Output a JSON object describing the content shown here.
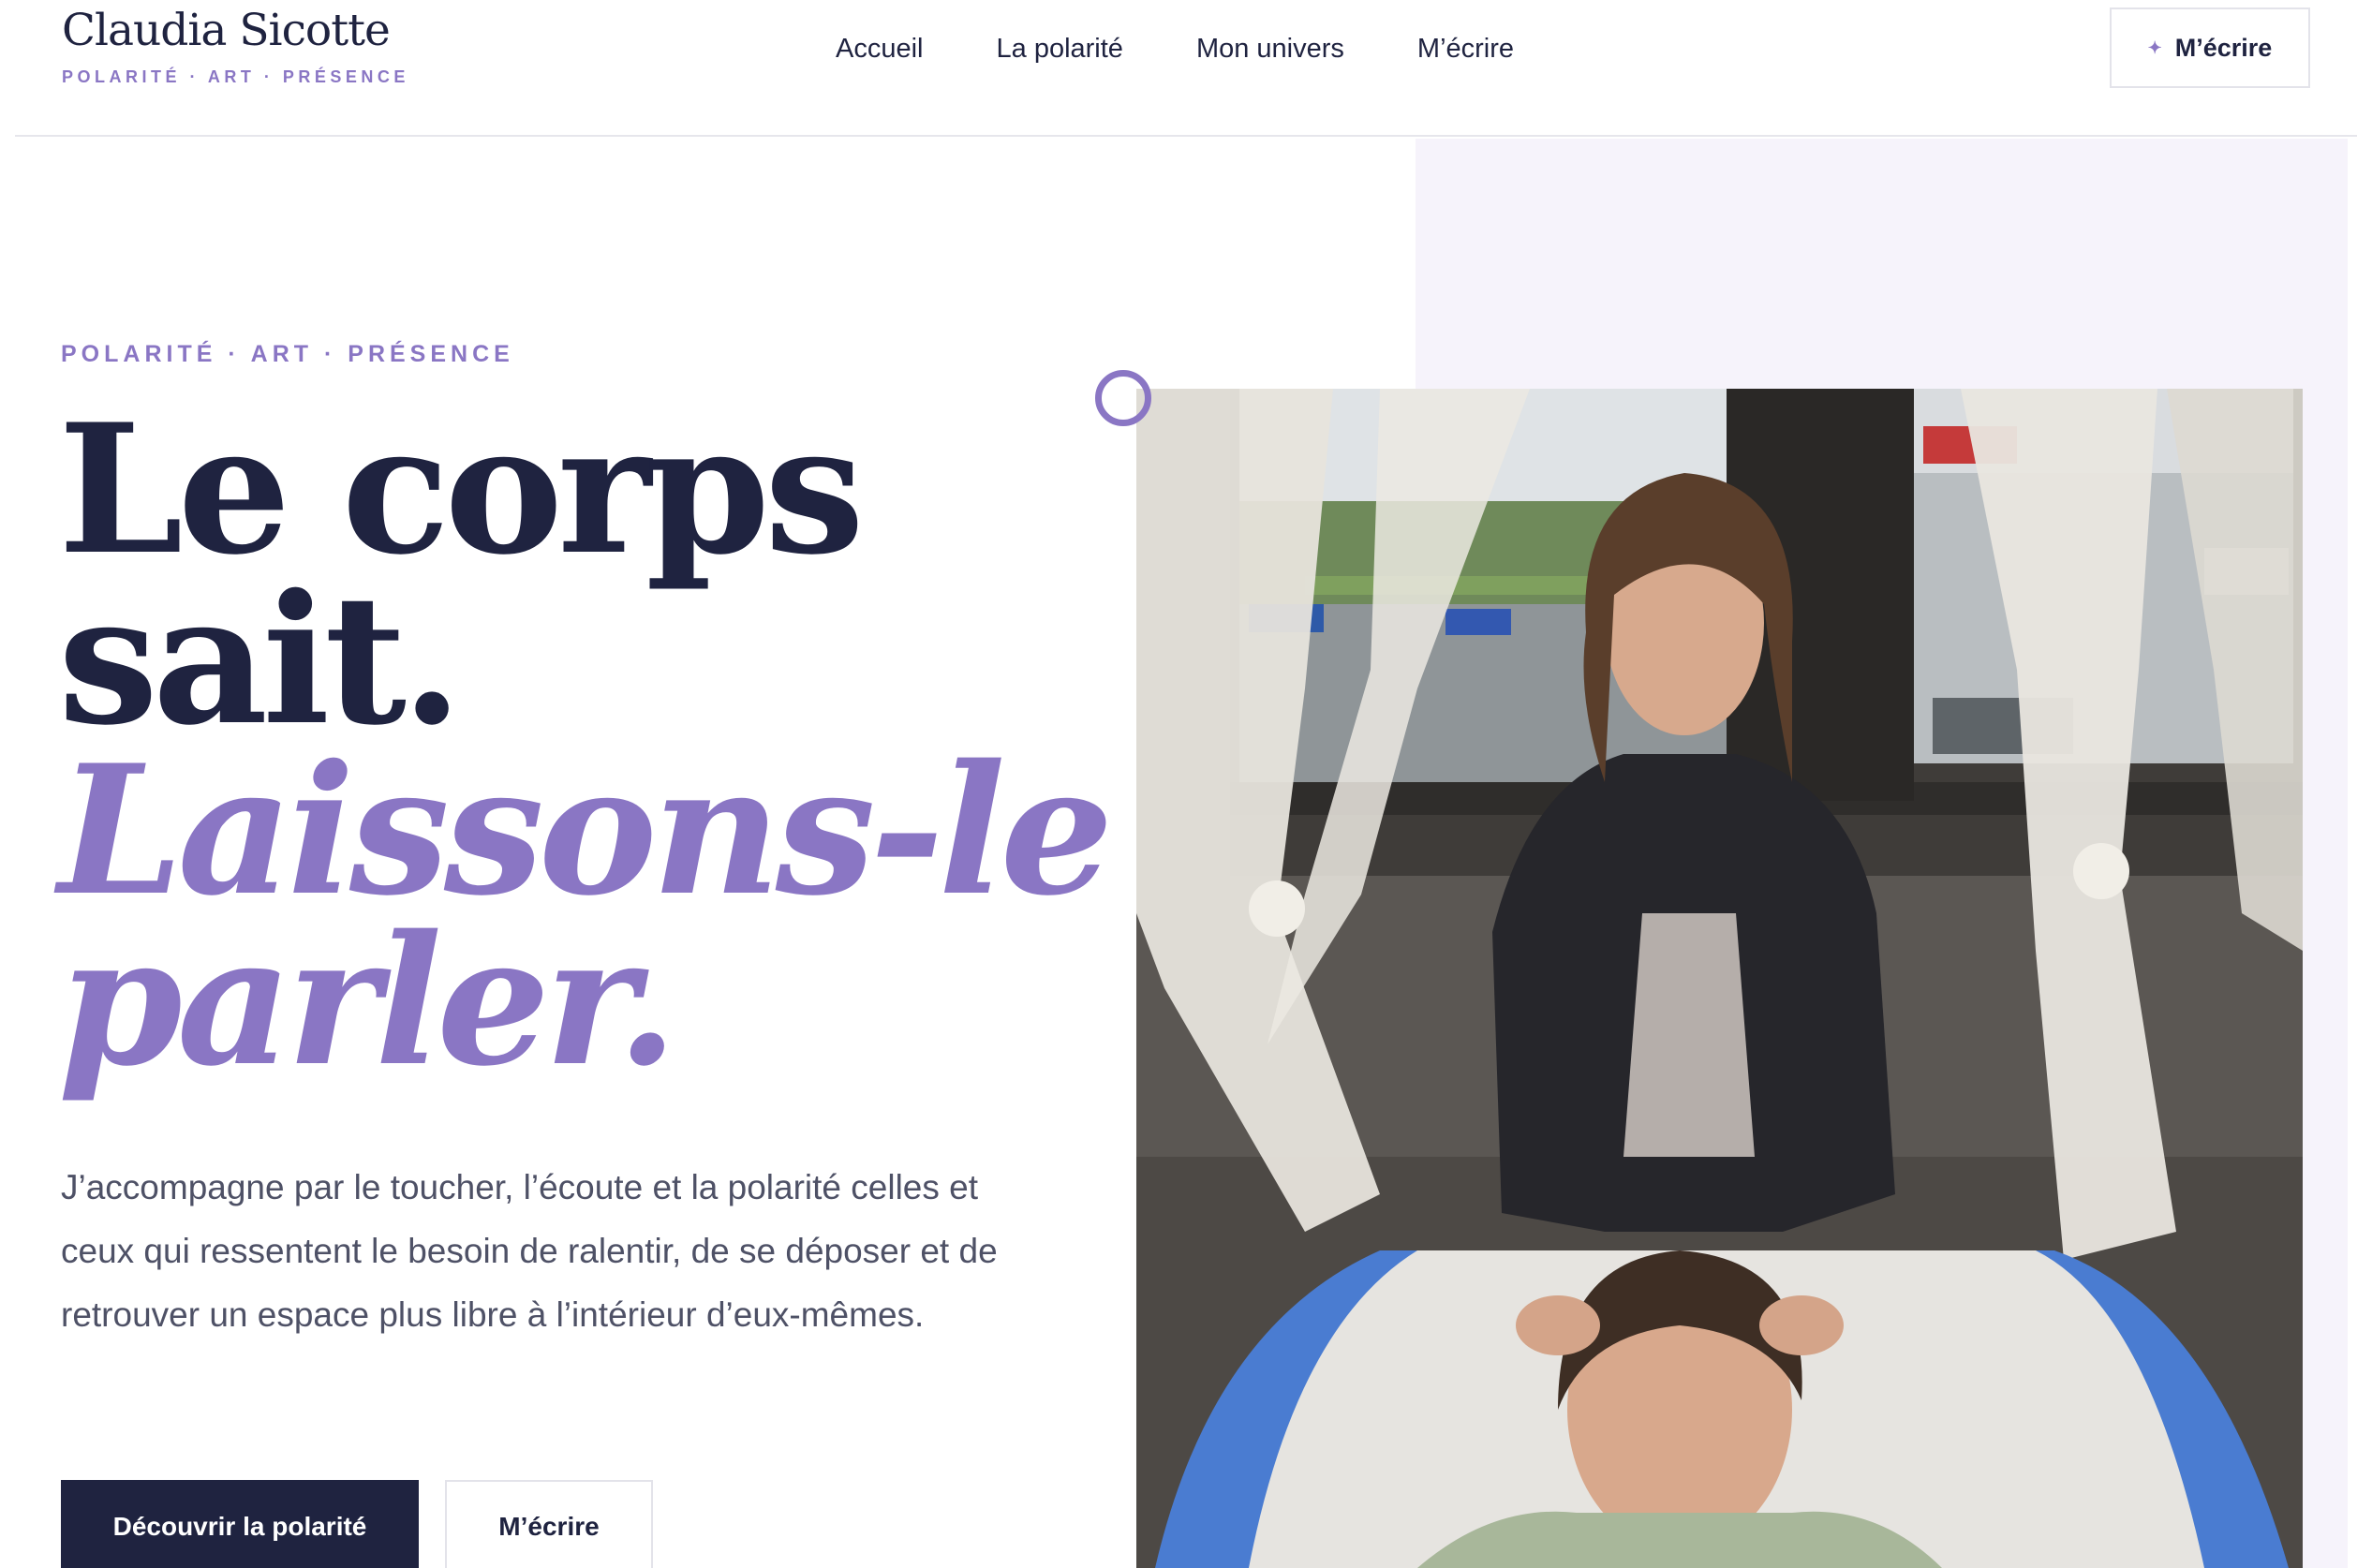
{
  "header": {
    "brand_name": "Claudia Sicotte",
    "brand_tagline": "POLARITÉ · ART · PRÉSENCE",
    "nav": [
      "Accueil",
      "La polarité",
      "Mon univers",
      "M’écrire"
    ],
    "cta_label": "M’écrire",
    "cta_icon": "sparkle-icon"
  },
  "hero": {
    "eyebrow": "POLARITÉ · ART · PRÉSENCE",
    "headline_line1": "Le corps",
    "headline_line2": "sait.",
    "headline_line3": "Laissons-le",
    "headline_line4": "parler.",
    "lede": "J’accompagne par le toucher, l’écoute et la polarité celles et ceux qui ressentent le besoin de ralentir, de se déposer et de retrouver un espace plus libre à l’intérieur d’eux-mêmes.",
    "primary_button": "Découvrir la polarité",
    "secondary_button": "M’écrire"
  },
  "colors": {
    "navy": "#1f2340",
    "lilac": "#8a76c4",
    "panel": "#f6f3fb",
    "body_text": "#4e5166"
  }
}
